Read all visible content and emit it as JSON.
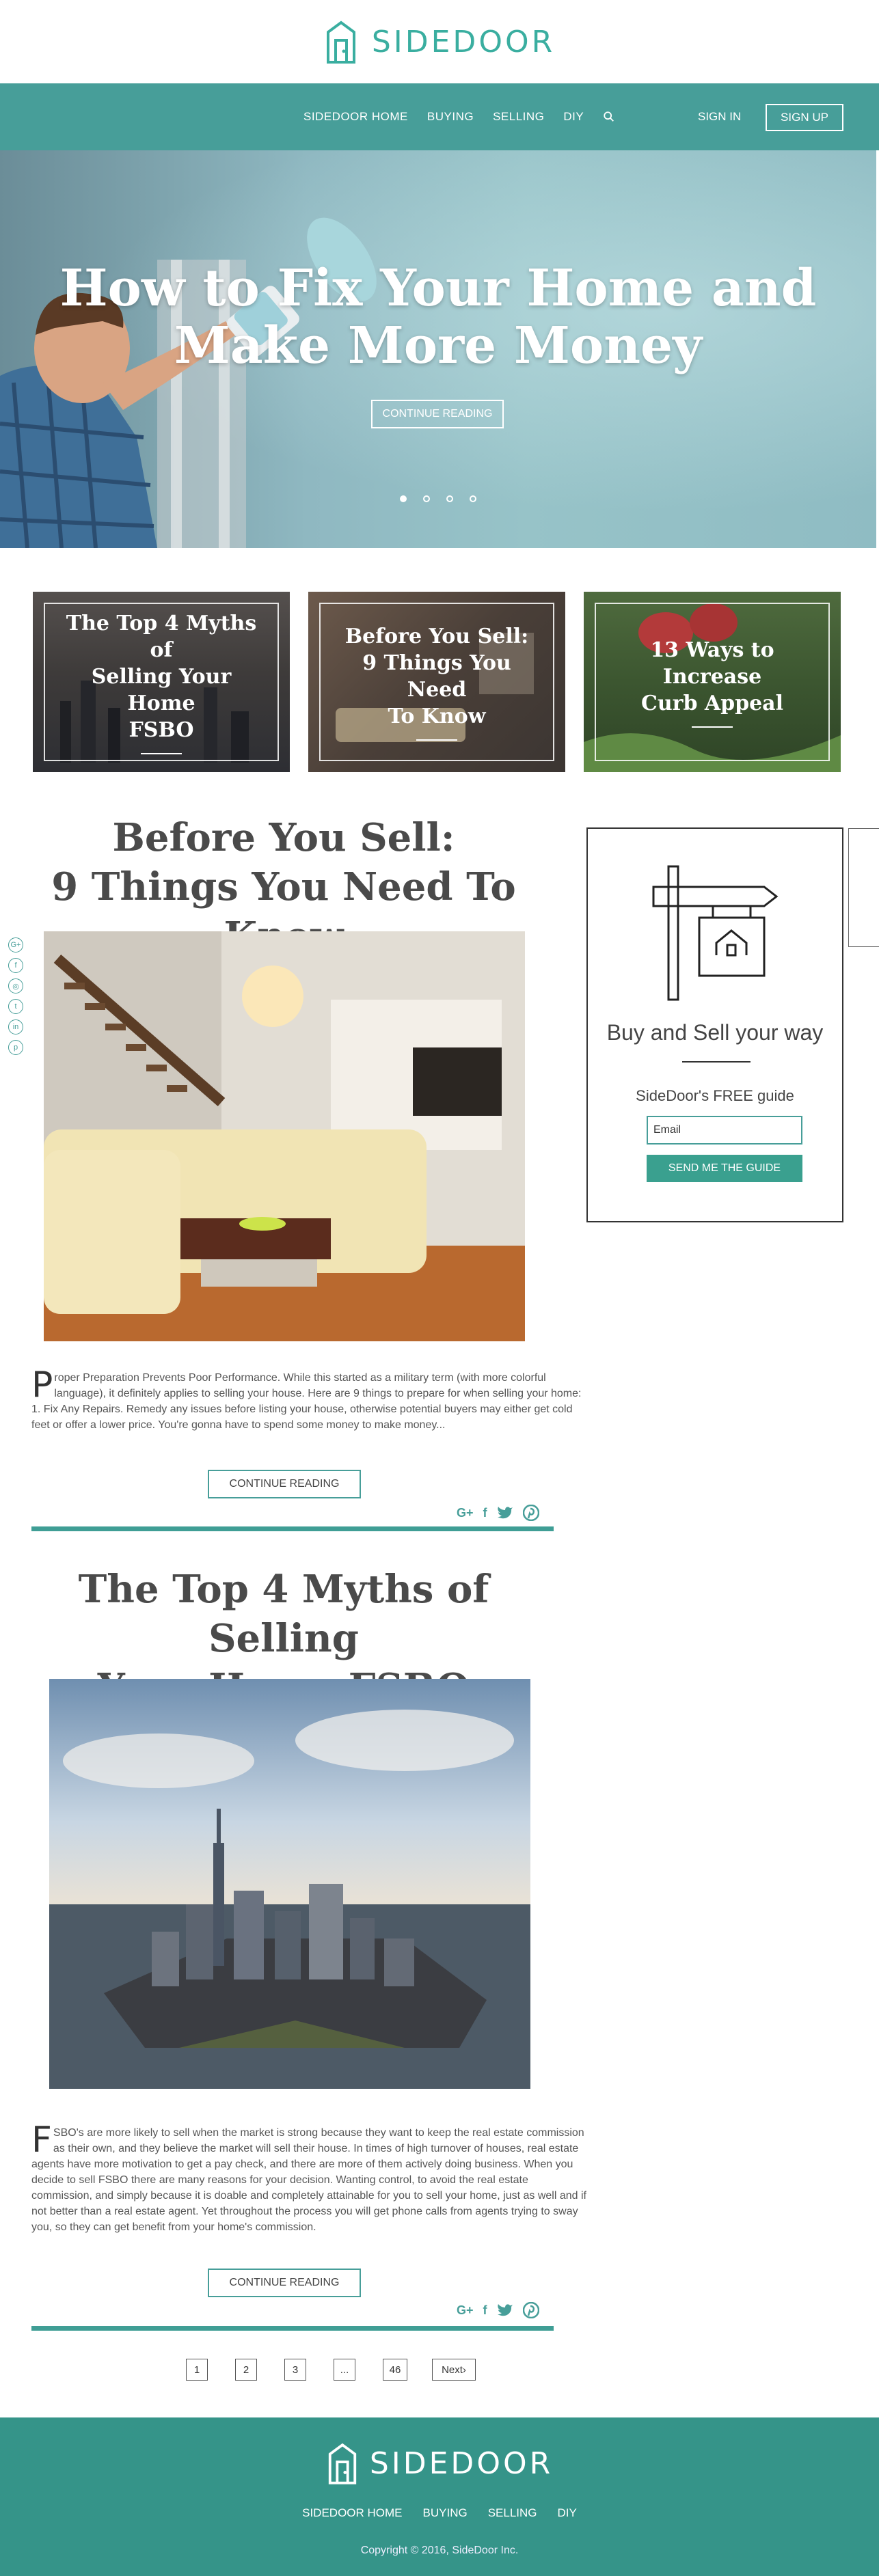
{
  "brand": {
    "name": "SIDEDOOR"
  },
  "nav": {
    "items": [
      "SIDEDOOR HOME",
      "BUYING",
      "SELLING",
      "DIY"
    ],
    "signin": "SIGN IN",
    "signup": "SIGN UP"
  },
  "hero": {
    "title_line1": "How to Fix Your Home and",
    "title_line2": "Make More Money",
    "button": "CONTINUE READING",
    "slides": 4,
    "active_slide": 1
  },
  "cards": [
    {
      "line1": "The Top 4 Myths of",
      "line2": "Selling Your Home",
      "line3": "FSBO"
    },
    {
      "line1": "Before You Sell:",
      "line2": "9 Things You Need",
      "line3": "To Know"
    },
    {
      "line1": "13 Ways to Increase",
      "line2": "Curb Appeal",
      "line3": ""
    }
  ],
  "articles": [
    {
      "title_line1": "Before You Sell:",
      "title_line2": "9 Things You Need To Know",
      "dropcap": "P",
      "body": "roper Preparation Prevents Poor Performance. While this started as a military term (with more colorful language), it definitely applies to selling your house. Here are 9 things to prepare for when selling your home:",
      "body2": "1. Fix Any Repairs. Remedy any issues before listing your house, otherwise potential buyers may either get cold feet or offer a lower price. You're gonna have to spend some money to make money...",
      "button": "CONTINUE READING"
    },
    {
      "title_line1": "The Top 4 Myths of Selling",
      "title_line2": "Your Home FSBO",
      "dropcap": "F",
      "body": "SBO's are more likely to sell when the market is strong because they want to keep the real estate commission as their own, and they believe the market will sell their house. In times of high turnover of houses, real estate agents have more motivation to get a pay check, and there are more of them actively doing business. When you decide to sell FSBO there are many reasons for your decision. Wanting control, to avoid the real estate commission, and simply because it is doable and completely attainable for you to sell your home, just as well and if not better than a real estate agent. Yet throughout the process you will get phone calls from agents trying to sway you, so they can get benefit from your home's commission.",
      "body2": "",
      "button": "CONTINUE READING"
    }
  ],
  "share": {
    "gplus": "G+",
    "fb": "f"
  },
  "widget": {
    "title": "Buy and Sell your way",
    "subtitle": "SideDoor's FREE guide",
    "email_placeholder": "Email",
    "button": "SEND ME THE GUIDE"
  },
  "pagination": {
    "pages": [
      "1",
      "2",
      "3",
      "...",
      "46"
    ],
    "next": "Next›"
  },
  "footer": {
    "links": [
      "SIDEDOOR HOME",
      "BUYING",
      "SELLING",
      "DIY"
    ],
    "copyright": "Copyright © 2016, SideDoor Inc."
  },
  "colors": {
    "brand": "#3aaea0",
    "nav": "#479e99",
    "footer": "#359489",
    "button": "#3aa08f"
  }
}
